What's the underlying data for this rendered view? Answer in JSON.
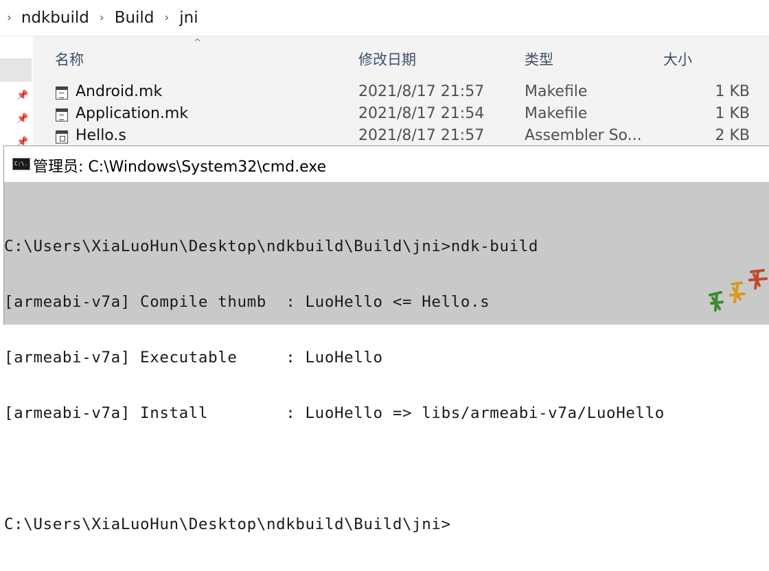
{
  "breadcrumb": {
    "items": [
      "ndkbuild",
      "Build",
      "jni"
    ]
  },
  "file_list": {
    "columns": {
      "name": "名称",
      "date": "修改日期",
      "type": "类型",
      "size": "大小"
    },
    "files": [
      {
        "name": "Android.mk",
        "date": "2021/8/17 21:57",
        "type": "Makefile",
        "size": "1 KB",
        "icon": "makefile-icon"
      },
      {
        "name": "Application.mk",
        "date": "2021/8/17 21:54",
        "type": "Makefile",
        "size": "1 KB",
        "icon": "makefile-icon"
      },
      {
        "name": "Hello.s",
        "date": "2021/8/17 21:57",
        "type": "Assembler So...",
        "size": "2 KB",
        "icon": "assembler-file-icon"
      }
    ]
  },
  "cmd": {
    "title": "管理员: C:\\Windows\\System32\\cmd.exe",
    "icon_text": "C:\\.",
    "lines": [
      "C:\\Users\\XiaLuoHun\\Desktop\\ndkbuild\\Build\\jni>ndk-build",
      "[armeabi-v7a] Compile thumb  : LuoHello <= Hello.s",
      "[armeabi-v7a] Executable     : LuoHello",
      "[armeabi-v7a] Install        : LuoHello => libs/armeabi-v7a/LuoHello",
      "",
      "C:\\Users\\XiaLuoHun\\Desktop\\ndkbuild\\Build\\jni>"
    ]
  },
  "colors": {
    "console_bg": "#c9c9c9",
    "console_text": "#1a1a1a",
    "filelist_bg": "#f3f3f3",
    "header_text": "#3d4e6b"
  }
}
